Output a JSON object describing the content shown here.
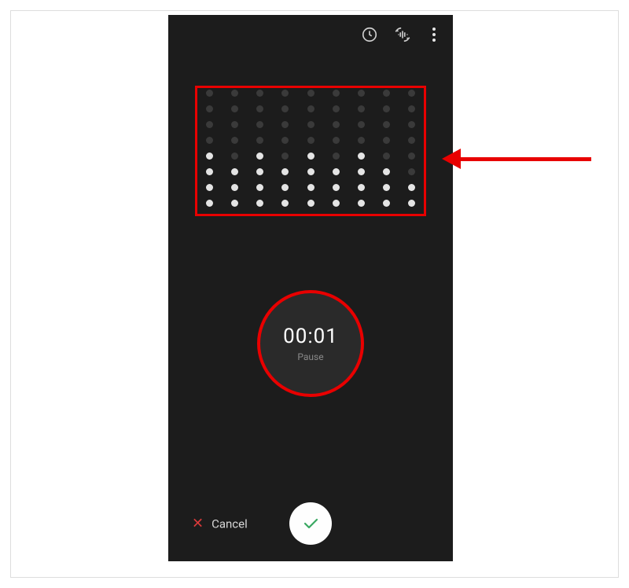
{
  "timer": {
    "value": "00:01",
    "state_label": "Pause"
  },
  "bottom": {
    "cancel_label": "Cancel"
  },
  "visualizer": {
    "columns": 9,
    "lit_heights": [
      4,
      3,
      4,
      3,
      4,
      3,
      4,
      3,
      2
    ],
    "rows_total": 8
  },
  "colors": {
    "accent": "#e80000",
    "confirm": "#3aa862",
    "cancel_x": "#d83a3a"
  }
}
